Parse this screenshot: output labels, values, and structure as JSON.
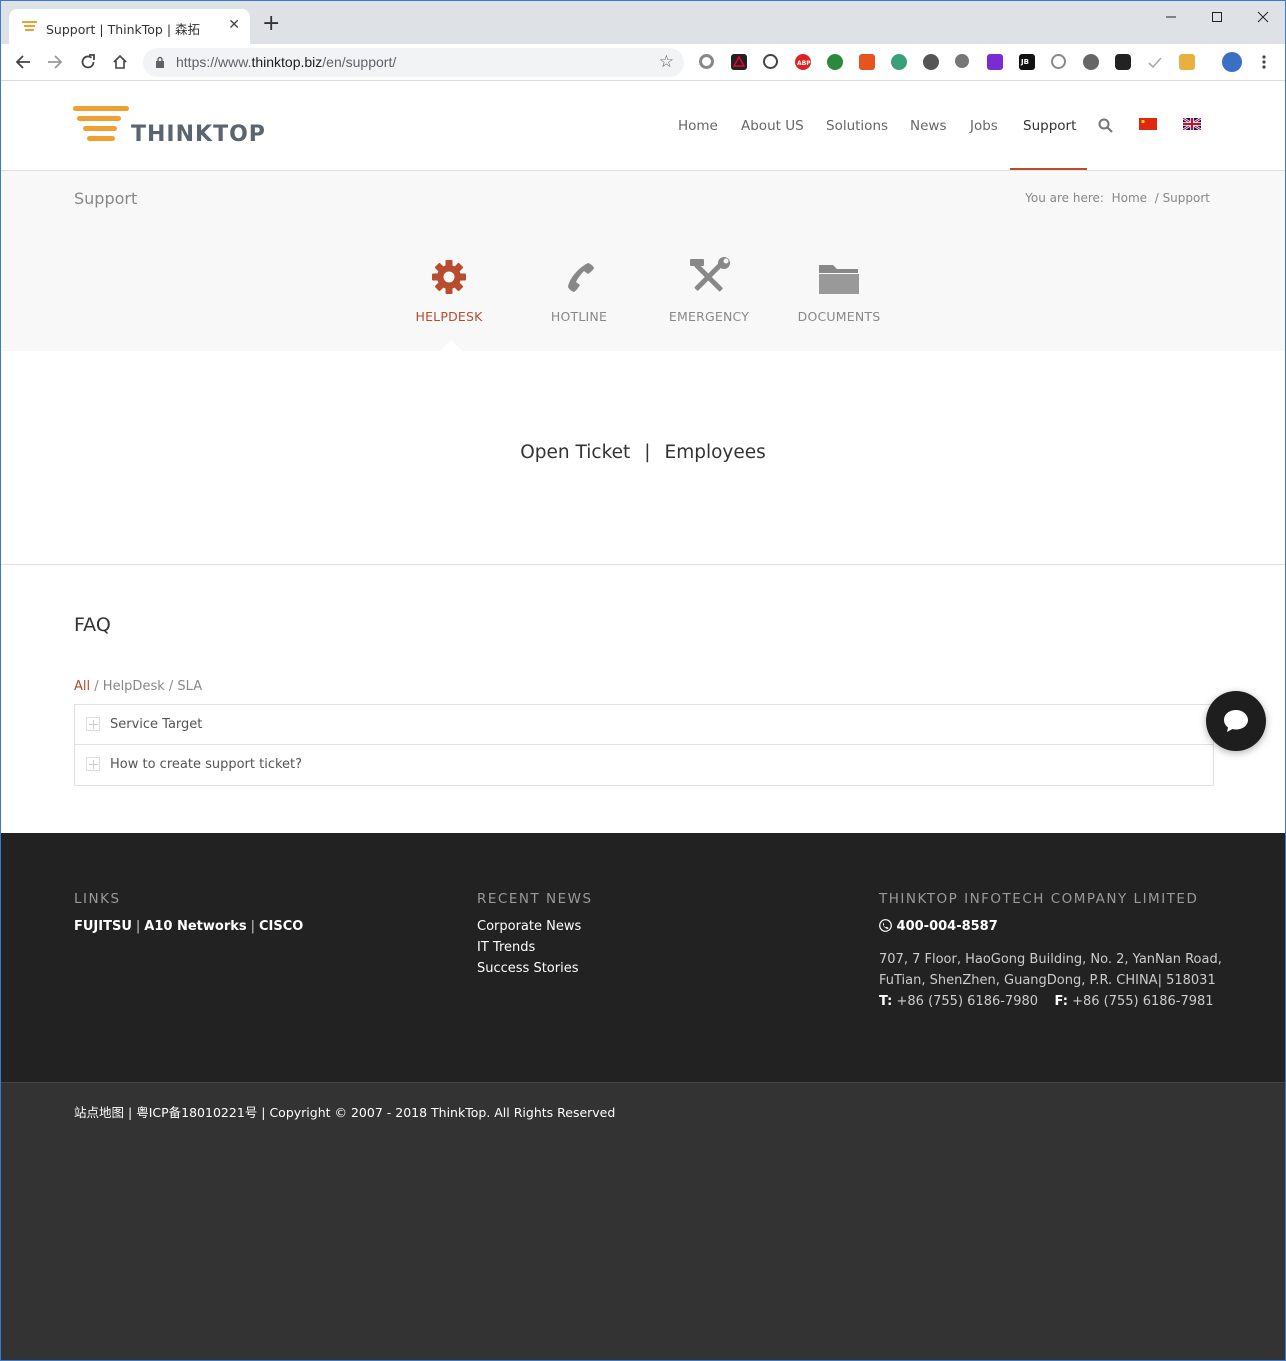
{
  "browser": {
    "tab_title": "Support | ThinkTop | 森拓",
    "url_prefix": "https://www.",
    "url_host": "thinktop.biz",
    "url_path": "/en/support/"
  },
  "header": {
    "logo_text": "THINKTOP",
    "nav": [
      "Home",
      "About US",
      "Solutions",
      "News",
      "Jobs",
      "Support"
    ],
    "active_nav": "Support",
    "accent_color": "#b84c2f"
  },
  "titlebar": {
    "title": "Support",
    "breadcrumb_prefix": "You are here:",
    "breadcrumb_home": "Home",
    "breadcrumb_sep": "/",
    "breadcrumb_current": "Support"
  },
  "services": [
    {
      "label": "HELPDESK",
      "icon": "gear-icon",
      "active": true
    },
    {
      "label": "HOTLINE",
      "icon": "phone-icon",
      "active": false
    },
    {
      "label": "EMERGENCY",
      "icon": "tools-icon",
      "active": false
    },
    {
      "label": "DOCUMENTS",
      "icon": "folder-icon",
      "active": false
    }
  ],
  "ticket": {
    "open_ticket": "Open Ticket",
    "separator": "|",
    "employees": "Employees"
  },
  "faq": {
    "title": "FAQ",
    "filter_all": "All",
    "filter_sep": "/",
    "filter_helpdesk": "HelpDesk",
    "filter_sla": "SLA",
    "items": [
      "Service Target",
      "How to create support ticket?"
    ]
  },
  "footer": {
    "links_title": "LINKS",
    "links": [
      "FUJITSU",
      "A10 Networks",
      "CISCO"
    ],
    "link_sep": "|",
    "news_title": "RECENT NEWS",
    "news": [
      "Corporate News",
      "IT Trends",
      "Success Stories"
    ],
    "company_title": "THINKTOP INFOTECH COMPANY LIMITED",
    "phone": "400-004-8587",
    "address_line1": "707, 7 Floor, HaoGong Building, No. 2, YanNan Road,",
    "address_line2": "FuTian, ShenZhen, GuangDong, P.R. CHINA| 518031",
    "tel_label": "T:",
    "tel": "+86 (755) 6186-7980",
    "fax_label": "F:",
    "fax": "+86 (755) 6186-7981"
  },
  "socket": {
    "sitemap": "站点地图",
    "sep": "|",
    "icp": "粤ICP备18010221号",
    "copyright": "| Copyright © 2007 - 2018 ThinkTop. All Rights Reserved"
  }
}
